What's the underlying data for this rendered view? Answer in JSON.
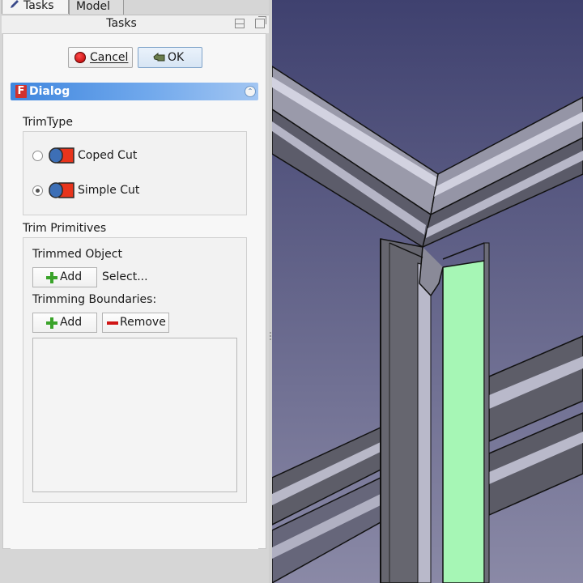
{
  "tabs": [
    {
      "label": "Tasks",
      "active": true,
      "icon": "pencil-icon"
    },
    {
      "label": "Model",
      "active": false
    }
  ],
  "panel": {
    "title": "Tasks"
  },
  "buttons": {
    "cancel": {
      "label": "Cancel",
      "mnemonic": "C",
      "icon": "red-circle-icon"
    },
    "ok": {
      "label": "OK",
      "mnemonic": "O",
      "icon": "ok-hand-icon"
    }
  },
  "dialog": {
    "title": "Dialog",
    "trim_type": {
      "label": "TrimType",
      "options": [
        {
          "label": "Coped Cut",
          "checked": false
        },
        {
          "label": "Simple Cut",
          "checked": true
        }
      ]
    },
    "trim_primitives": {
      "label": "Trim Primitives",
      "trimmed_object_label": "Trimmed Object",
      "add_label": "Add",
      "select_text": "Select...",
      "trimming_boundaries_label": "Trimming Boundaries:",
      "boundaries_add_label": "Add",
      "remove_label": "Remove",
      "boundaries": []
    }
  },
  "colors": {
    "dialog_bar": "#3f86de",
    "viewport_bg_top": "#3f416f",
    "viewport_bg_bottom": "#8a89a6",
    "selected_face": "#a6f6b5",
    "beam_face": "#b9b9c8"
  }
}
